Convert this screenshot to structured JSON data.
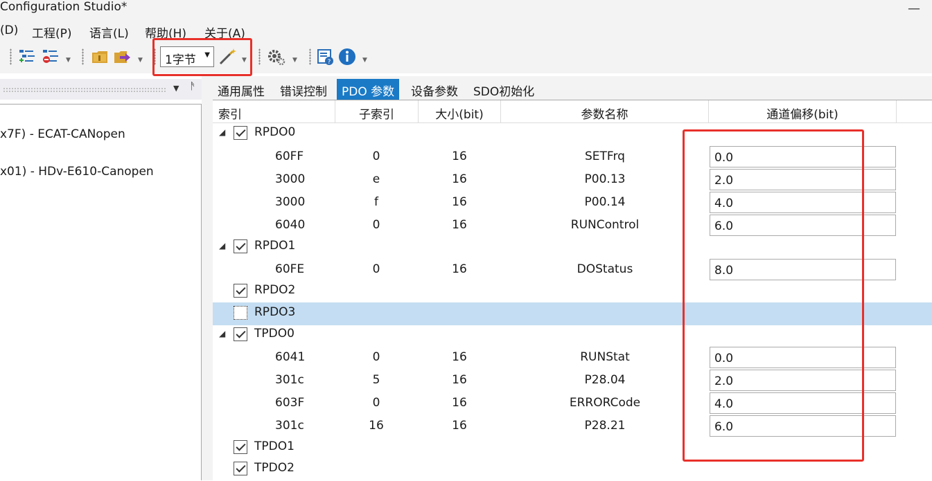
{
  "window": {
    "title": "Configuration Studio*",
    "minimize_glyph": "—"
  },
  "menu": [
    {
      "label": "(D)"
    },
    {
      "label": "工程(P)"
    },
    {
      "label": "语言(L)"
    },
    {
      "label": "帮助(H)"
    },
    {
      "label": "关于(A)"
    }
  ],
  "toolbar": {
    "icons": [
      "add-node-icon",
      "remove-node-icon",
      "folder-icon",
      "export-icon",
      "magic-wand-icon",
      "settings-icon",
      "help-doc-icon",
      "info-icon"
    ],
    "size_combo_value": "1字节",
    "dropdown_glyph": "▼",
    "pin_glyph": "▾ ㅍ"
  },
  "left_panel": {
    "nodes": [
      {
        "label": "x7F)  -  ECAT-CANopen"
      },
      {
        "label": "x01)  -  HDv-E610-Canopen"
      }
    ]
  },
  "tabs": [
    {
      "label": "通用属性",
      "active": false
    },
    {
      "label": "错误控制",
      "active": false
    },
    {
      "label": "PDO 参数",
      "active": true
    },
    {
      "label": "设备参数",
      "active": false
    },
    {
      "label": "SDO初始化",
      "active": false
    }
  ],
  "grid": {
    "columns": [
      "索引",
      "子索引",
      "大小(bit)",
      "参数名称",
      "通道偏移(bit)"
    ],
    "rows": [
      {
        "kind": "group",
        "label": "RPDO0",
        "expanded": true,
        "checked": true
      },
      {
        "kind": "item",
        "index": "60FF",
        "subindex": "0",
        "size": "16",
        "name": "SETFrq",
        "offset": "0.0"
      },
      {
        "kind": "item",
        "index": "3000",
        "subindex": "e",
        "size": "16",
        "name": "P00.13",
        "offset": "2.0"
      },
      {
        "kind": "item",
        "index": "3000",
        "subindex": "f",
        "size": "16",
        "name": "P00.14",
        "offset": "4.0"
      },
      {
        "kind": "item",
        "index": "6040",
        "subindex": "0",
        "size": "16",
        "name": "RUNControl",
        "offset": "6.0"
      },
      {
        "kind": "group",
        "label": "RPDO1",
        "expanded": true,
        "checked": true
      },
      {
        "kind": "item",
        "index": "60FE",
        "subindex": "0",
        "size": "16",
        "name": "DOStatus",
        "offset": "8.0"
      },
      {
        "kind": "group",
        "label": "RPDO2",
        "expanded": false,
        "checked": true
      },
      {
        "kind": "group",
        "label": "RPDO3",
        "expanded": false,
        "checked": false,
        "selected": true
      },
      {
        "kind": "group",
        "label": "TPDO0",
        "expanded": true,
        "checked": true
      },
      {
        "kind": "item",
        "index": "6041",
        "subindex": "0",
        "size": "16",
        "name": "RUNStat",
        "offset": "0.0"
      },
      {
        "kind": "item",
        "index": "301c",
        "subindex": "5",
        "size": "16",
        "name": "P28.04",
        "offset": "2.0"
      },
      {
        "kind": "item",
        "index": "603F",
        "subindex": "0",
        "size": "16",
        "name": "ERRORCode",
        "offset": "4.0"
      },
      {
        "kind": "item",
        "index": "301c",
        "subindex": "16",
        "size": "16",
        "name": "P28.21",
        "offset": "6.0"
      },
      {
        "kind": "group",
        "label": "TPDO1",
        "expanded": false,
        "checked": true
      },
      {
        "kind": "group",
        "label": "TPDO2",
        "expanded": false,
        "checked": true
      }
    ]
  },
  "colors": {
    "accent": "#1a7ac6",
    "selection": "#c4ddf2",
    "annotation": "#e8302a"
  }
}
